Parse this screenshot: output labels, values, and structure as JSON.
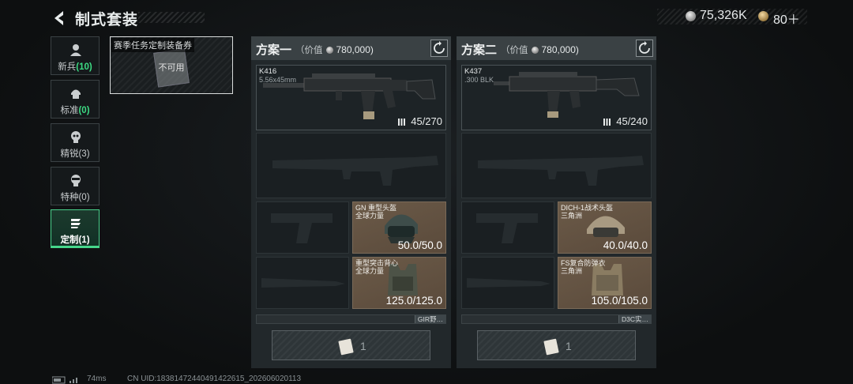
{
  "header": {
    "title": "制式套装",
    "silver": "75,326K",
    "gold": "80＋"
  },
  "categories": [
    {
      "name": "新兵",
      "count": "(10)",
      "icon": "soldier-icon",
      "highlight": true
    },
    {
      "name": "标准",
      "count": "(0)",
      "icon": "helmet-icon",
      "highlight": true
    },
    {
      "name": "精锐",
      "count": "(3)",
      "icon": "skull-icon",
      "highlight": false
    },
    {
      "name": "特种",
      "count": "(0)",
      "icon": "mask-icon",
      "highlight": false
    },
    {
      "name": "定制",
      "count": "(1)",
      "icon": "custom-icon",
      "highlight": false
    }
  ],
  "voucher": {
    "title": "赛季任务定制装备券",
    "status": "不可用"
  },
  "plans": [
    {
      "name": "方案一",
      "value_label": "（价值",
      "value": "780,000)",
      "primary": {
        "name": "K416",
        "ammo_type": "5.56x45mm",
        "ammo": "45/270"
      },
      "helmet": {
        "name": "GN 重型头盔",
        "source": "全球力量",
        "durability": "50.0/50.0"
      },
      "armor": {
        "name": "重型突击背心",
        "source": "全球力量",
        "durability": "125.0/125.0"
      },
      "bag_tag": "GIR野…",
      "voucher_count": "1"
    },
    {
      "name": "方案二",
      "value_label": "（价值",
      "value": "780,000)",
      "primary": {
        "name": "K437",
        "ammo_type": ".300 BLK",
        "ammo": "45/240"
      },
      "helmet": {
        "name": "DICH-1战术头盔",
        "source": "三角洲",
        "durability": "40.0/40.0"
      },
      "armor": {
        "name": "FS复合防弹衣",
        "source": "三角洲",
        "durability": "105.0/105.0"
      },
      "bag_tag": "D3C实…",
      "voucher_count": "1"
    }
  ],
  "footer": {
    "ping": "74ms",
    "uid": "CN UID:18381472440491422615_202606020113"
  },
  "colors": {
    "accent": "#3ddc84",
    "panel": "#22282b",
    "gear_bg": "#6b5a48"
  }
}
